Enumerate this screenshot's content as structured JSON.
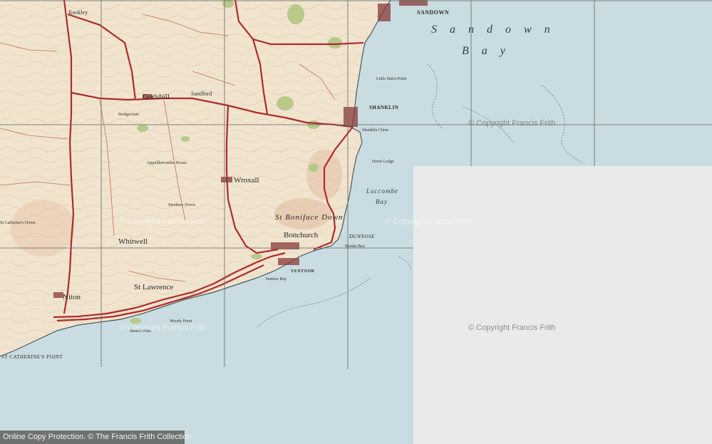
{
  "map": {
    "colors": {
      "land": "#f0e4cf",
      "sea": "#c9dce1",
      "road": "#b02a2a",
      "woodland": "#b8c98a",
      "contour": "#d9a488",
      "grid": "#6f6f6f",
      "blank_tile": "#e9eaeb"
    },
    "labels": {
      "sandown": "SANDOWN",
      "sandown_bay_1": "Sandown",
      "sandown_bay_2": "Bay",
      "shanklin": "SHANKLIN",
      "godshill": "Godshill",
      "wroxall": "Wroxall",
      "whitwell": "Whitwell",
      "niton": "Niton",
      "st_lawrence": "St Lawrence",
      "bonchurch": "Bonchurch",
      "ventnor": "VENTNOR",
      "ventnor_bay": "Ventnor Bay",
      "dunnose": "DUNNOSE",
      "luccombe_bay_1": "Luccombe",
      "luccombe_bay_2": "Bay",
      "monks_bay": "Monks Bay",
      "st_catherines_point": "ST CATHERINE'S POINT",
      "binnel_point": "Binnel Point",
      "woody_point": "Woody Point",
      "st_boniface_down": "St Boniface Down",
      "appuldurcombe": "Appuldurcombe House",
      "shanklin_chine": "Shanklin Chine",
      "horse_ledge": "Horse Ledge",
      "little_stairs_point": "Little Stairs Point",
      "rookley": "Rookley",
      "sandford": "Sandford",
      "bridgecourt": "Bridgecourt",
      "stenbury_down": "Stenbury Down",
      "st_catherines_down": "St Catherine's Down"
    },
    "watermarks": [
      "© Copyright Francis Frith",
      "© Copyright Francis Frith",
      "© Copyright Francis Frith",
      "© Copyright Francis Frith",
      "© Copyright Francis Frith"
    ]
  },
  "footer": {
    "text": "Online Copy Protection.  © The Francis Frith Collection"
  }
}
